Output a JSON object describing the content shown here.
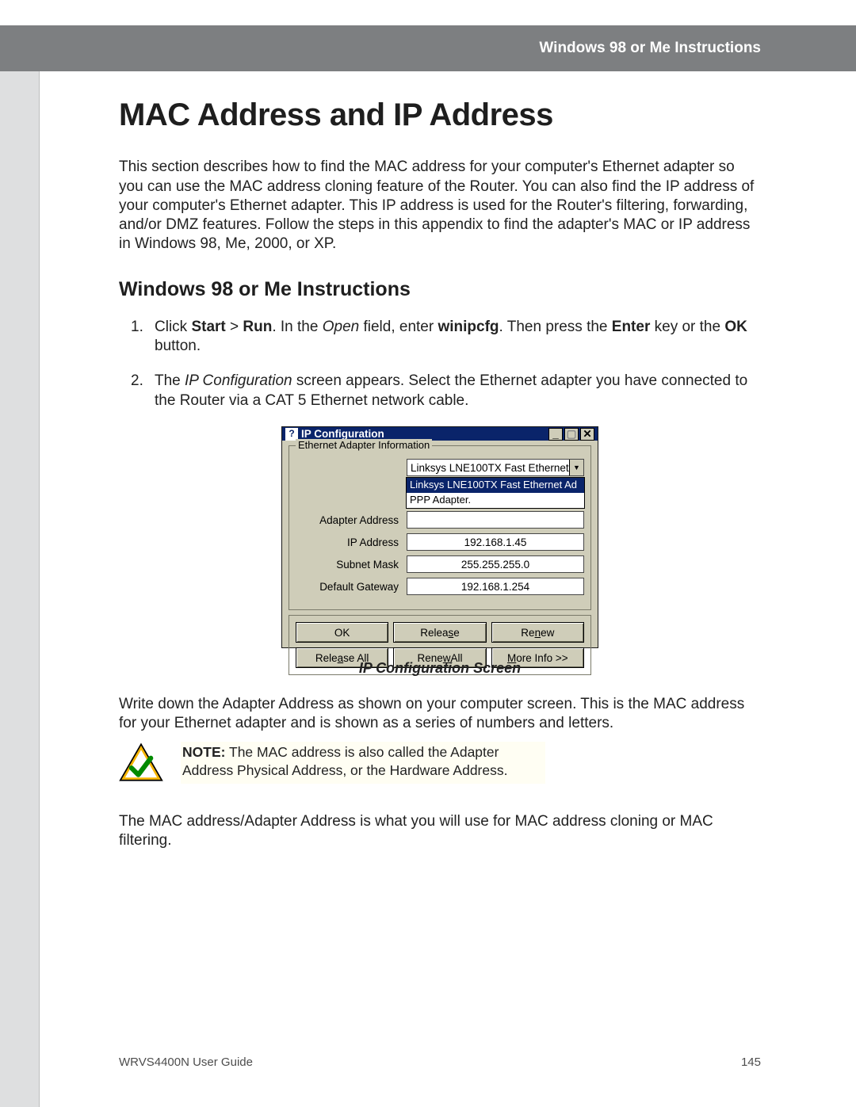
{
  "header": {
    "title": "Windows 98 or Me Instructions"
  },
  "h1": "MAC Address and IP Address",
  "intro": "This section describes how to find the MAC address for your computer's Ethernet adapter so you can use the MAC address cloning feature of the Router. You can also find the IP address of your computer's Ethernet adapter. This IP address is used for the Router's filtering, forwarding, and/or DMZ features. Follow the steps in this appendix to find the adapter's MAC or IP address in Windows 98, Me, 2000, or XP.",
  "h2": "Windows 98 or Me Instructions",
  "steps": {
    "s1": {
      "num": "1.",
      "pre": "Click ",
      "b1": "Start",
      "gt": " > ",
      "b2": "Run",
      "mid1": ". In the ",
      "i1": "Open",
      "mid2": " field, enter ",
      "b3": "winipcfg",
      "mid3": ". Then press the ",
      "b4": "Enter",
      "mid4": " key or the ",
      "b5": "OK",
      "tail": " button."
    },
    "s2": {
      "num": "2.",
      "pre": "The ",
      "i1": "IP Configuration",
      "tail": " screen appears. Select the Ethernet adapter you have connected to the Router via a CAT 5 Ethernet network cable."
    }
  },
  "ipconfig": {
    "title": "IP Configuration",
    "group_label": "Ethernet  Adapter Information",
    "combo_selected": "Linksys LNE100TX Fast Ethernet",
    "dropdown": {
      "opt1": "Linksys LNE100TX Fast Ethernet Ad",
      "opt2": "PPP Adapter."
    },
    "rows": {
      "adapter_label": "Adapter Address",
      "ip_label": "IP Address",
      "ip_value": "192.168.1.45",
      "subnet_label": "Subnet Mask",
      "subnet_value": "255.255.255.0",
      "gateway_label": "Default Gateway",
      "gateway_value": "192.168.1.254"
    },
    "buttons": {
      "ok": "OK",
      "release": "Release",
      "renew": "Renew",
      "release_all": "Release All",
      "renew_all": "Renew All",
      "more_info": "More Info >>"
    }
  },
  "caption": "IP Configuration Screen",
  "after1": "Write down the Adapter Address as shown on your computer screen. This is the MAC address for your Ethernet adapter and is shown as a series of numbers and letters.",
  "note": {
    "b": "NOTE:",
    "text": " The MAC address is also called the Adapter Address Physical Address, or the Hardware Address."
  },
  "after2": "The MAC address/Adapter Address is what you will use for MAC address cloning or MAC filtering.",
  "footer": {
    "left": "WRVS4400N User Guide",
    "right": "145"
  }
}
